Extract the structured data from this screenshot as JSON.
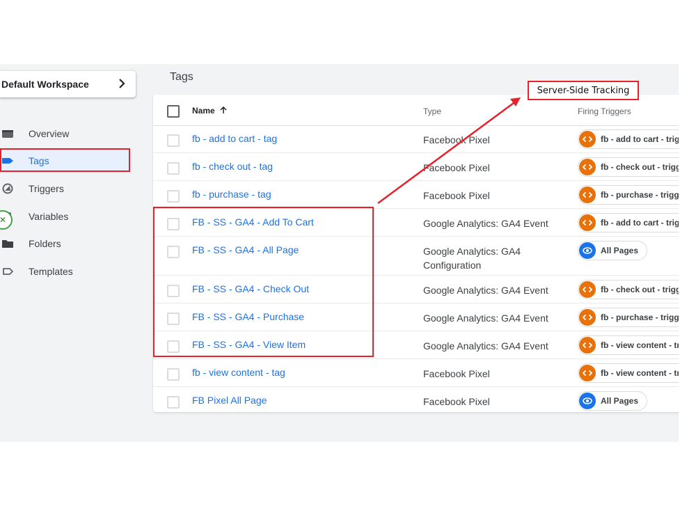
{
  "workspace": {
    "label": "Default Workspace",
    "chevron_icon": "chevron-right-icon"
  },
  "sidebar": {
    "items": [
      {
        "label": "Overview",
        "icon": "overview-icon",
        "active": false
      },
      {
        "label": "Tags",
        "icon": "tag-icon",
        "active": true
      },
      {
        "label": "Triggers",
        "icon": "trigger-icon",
        "active": false
      },
      {
        "label": "Variables",
        "icon": "variables-icon",
        "active": false
      },
      {
        "label": "Folders",
        "icon": "folder-icon",
        "active": false
      },
      {
        "label": "Templates",
        "icon": "template-icon",
        "active": false
      }
    ],
    "badge_icon": "close-icon"
  },
  "page": {
    "title": "Tags"
  },
  "table": {
    "columns": {
      "name": "Name",
      "sort_icon": "arrow-up-icon",
      "type": "Type",
      "triggers": "Firing Triggers"
    },
    "rows": [
      {
        "name": "fb - add to cart - tag",
        "type": "Facebook Pixel",
        "trigger": "fb - add to cart - trig",
        "trigger_icon": "custom-event-icon",
        "trigger_color": "#e8710a"
      },
      {
        "name": "fb - check out - tag",
        "type": "Facebook Pixel",
        "trigger": "fb - check out - trigg",
        "trigger_icon": "custom-event-icon",
        "trigger_color": "#e8710a"
      },
      {
        "name": "fb - purchase - tag",
        "type": "Facebook Pixel",
        "trigger": "fb - purchase - trigge",
        "trigger_icon": "custom-event-icon",
        "trigger_color": "#e8710a"
      },
      {
        "name": "FB - SS - GA4 - Add To Cart",
        "type": "Google Analytics: GA4 Event",
        "trigger": "fb - add to cart - trig",
        "trigger_icon": "custom-event-icon",
        "trigger_color": "#e8710a"
      },
      {
        "name": "FB - SS - GA4 - All Page",
        "type": "Google Analytics: GA4 Configuration",
        "trigger": "All Pages",
        "trigger_icon": "eye-icon",
        "trigger_color": "#1a73e8"
      },
      {
        "name": "FB - SS - GA4 - Check Out",
        "type": "Google Analytics: GA4 Event",
        "trigger": "fb - check out - trigg",
        "trigger_icon": "custom-event-icon",
        "trigger_color": "#e8710a"
      },
      {
        "name": "FB - SS - GA4 - Purchase",
        "type": "Google Analytics: GA4 Event",
        "trigger": "fb - purchase - trigge",
        "trigger_icon": "custom-event-icon",
        "trigger_color": "#e8710a"
      },
      {
        "name": "FB - SS - GA4 - View Item",
        "type": "Google Analytics: GA4 Event",
        "trigger": "fb - view content - tr",
        "trigger_icon": "custom-event-icon",
        "trigger_color": "#e8710a"
      },
      {
        "name": "fb - view content - tag",
        "type": "Facebook Pixel",
        "trigger": "fb - view content - tr",
        "trigger_icon": "custom-event-icon",
        "trigger_color": "#e8710a"
      },
      {
        "name": "FB Pixel All Page",
        "type": "Facebook Pixel",
        "trigger": "All Pages",
        "trigger_icon": "eye-icon",
        "trigger_color": "#1a73e8"
      }
    ]
  },
  "annotation": {
    "label": "Server-Side Tracking",
    "color": "#e8202a"
  }
}
